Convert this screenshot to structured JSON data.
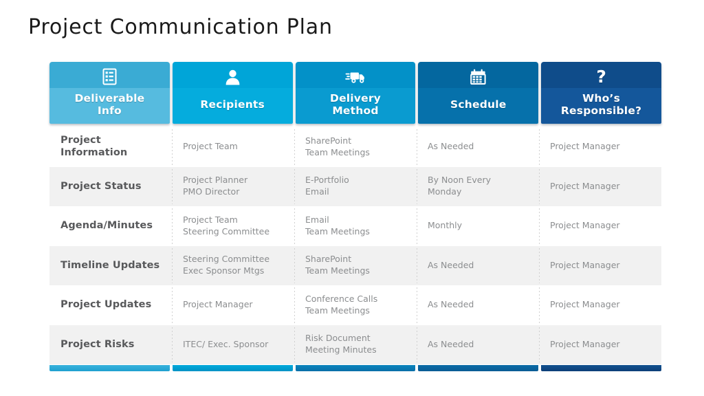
{
  "title": "Project Communication Plan",
  "table": {
    "headers": [
      {
        "label": "Deliverable\nInfo",
        "icon": "clipboard-list-icon",
        "color": "#3aabd4"
      },
      {
        "label": "Recipients",
        "icon": "person-icon",
        "color": "#00a5d8"
      },
      {
        "label": "Delivery\nMethod",
        "icon": "delivery-truck-icon",
        "color": "#0391c8"
      },
      {
        "label": "Schedule",
        "icon": "calendar-icon",
        "color": "#04679f"
      },
      {
        "label": "Who’s\nResponsible?",
        "icon": "question-mark-icon",
        "color": "#0f4c8a"
      }
    ],
    "rows": [
      {
        "deliverable": "Project\nInformation",
        "recipients": "Project Team",
        "delivery_method": "SharePoint\nTeam Meetings",
        "schedule": "As Needed",
        "responsible": "Project Manager"
      },
      {
        "deliverable": "Project Status",
        "recipients": "Project Planner\nPMO Director",
        "delivery_method": "E-Portfolio\nEmail",
        "schedule": "By Noon Every\nMonday",
        "responsible": "Project Manager"
      },
      {
        "deliverable": "Agenda/Minutes",
        "recipients": "Project Team\nSteering Committee",
        "delivery_method": "Email\nTeam Meetings",
        "schedule": "Monthly",
        "responsible": "Project Manager"
      },
      {
        "deliverable": "Timeline Updates",
        "recipients": "Steering Committee\nExec Sponsor Mtgs",
        "delivery_method": "SharePoint\nTeam Meetings",
        "schedule": "As Needed",
        "responsible": "Project Manager"
      },
      {
        "deliverable": "Project Updates",
        "recipients": "Project Manager",
        "delivery_method": "Conference Calls\nTeam Meetings",
        "schedule": "As Needed",
        "responsible": "Project Manager"
      },
      {
        "deliverable": "Project Risks",
        "recipients": "ITEC/ Exec. Sponsor",
        "delivery_method": "Risk Document\nMeeting Minutes",
        "schedule": "As Needed",
        "responsible": "Project Manager"
      }
    ],
    "footer_colors": [
      "#1fa0cf",
      "#0092c4",
      "#0a6fa8",
      "#0a5b94",
      "#0d3f78"
    ]
  }
}
